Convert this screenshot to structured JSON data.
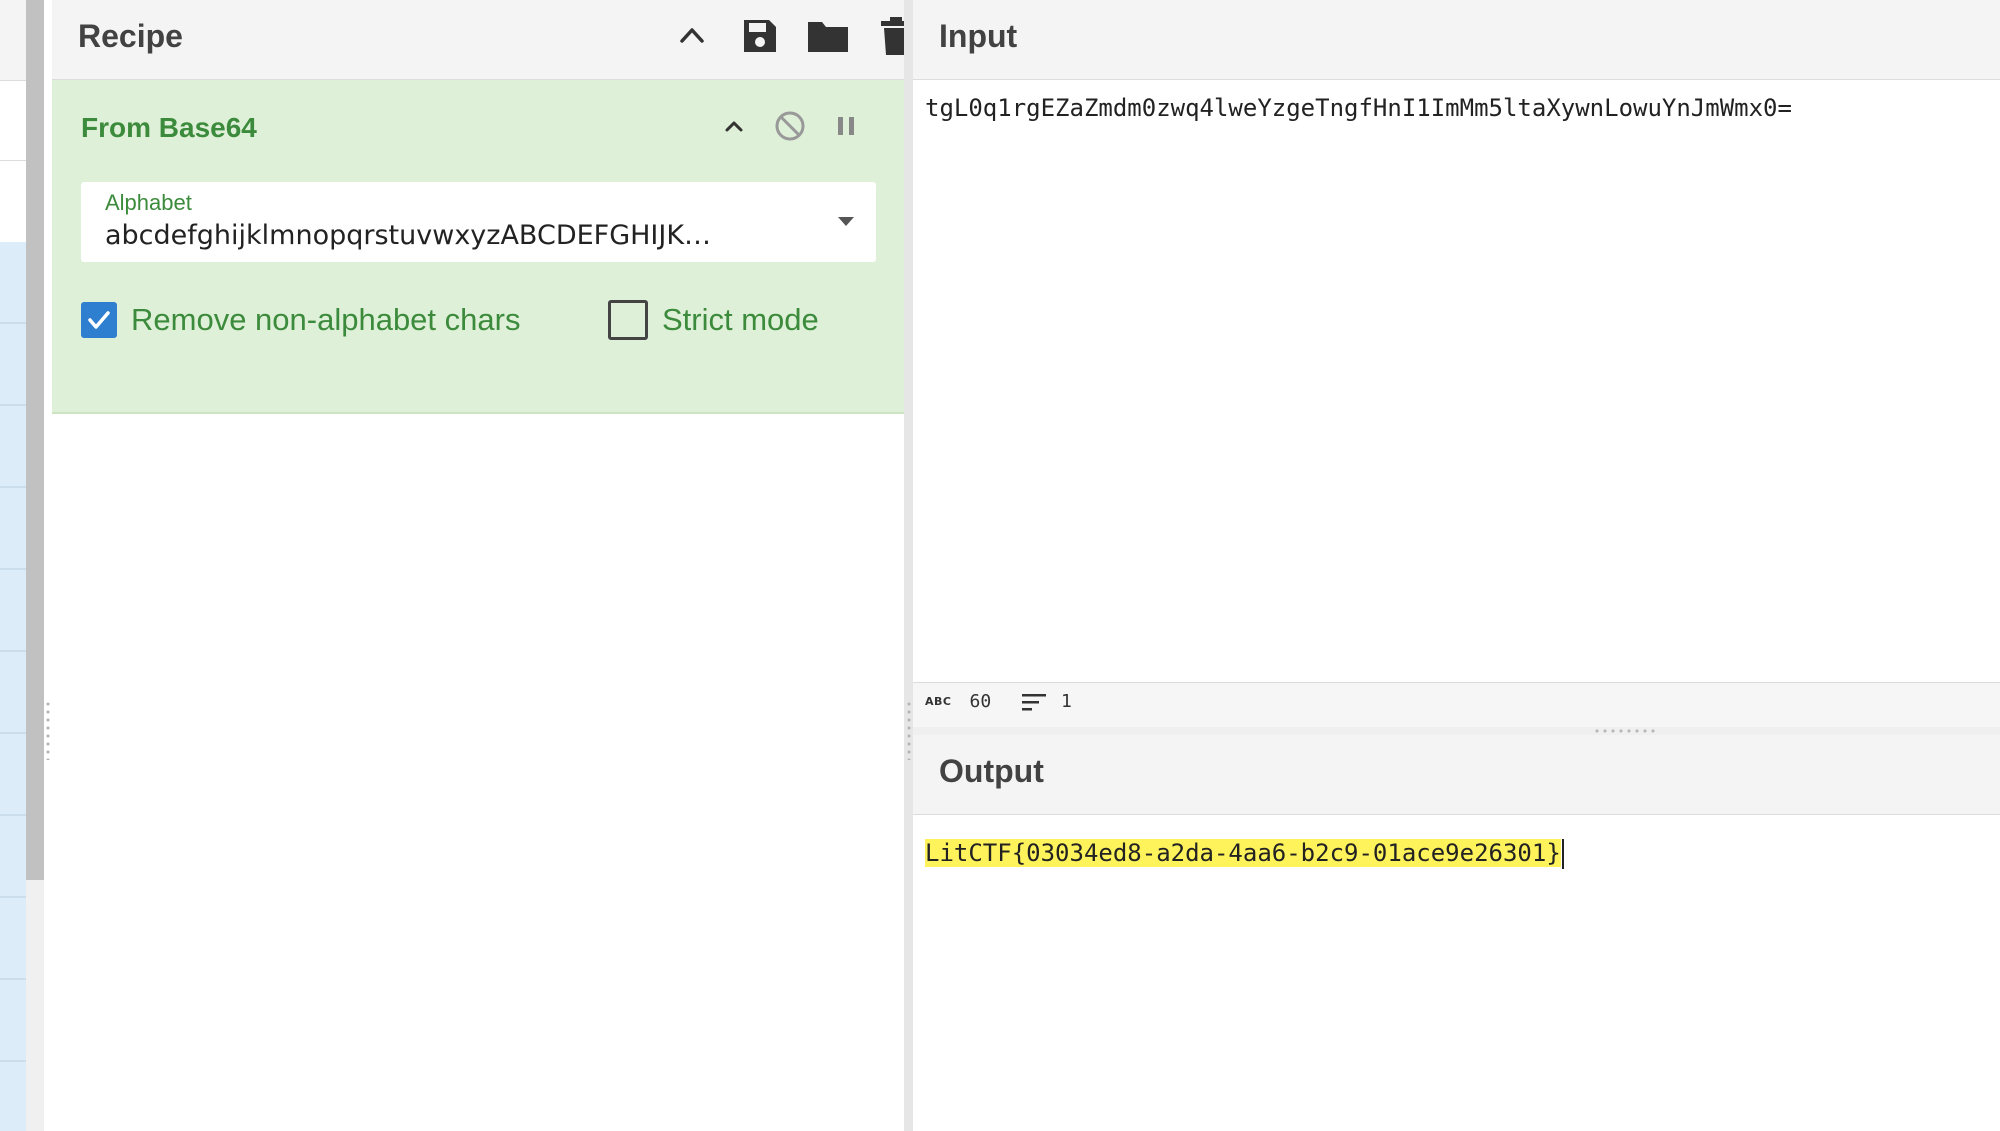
{
  "recipe": {
    "title": "Recipe",
    "operation": {
      "name": "From Base64",
      "alphabet_label": "Alphabet",
      "alphabet_value": "abcdefghijklmnopqrstuvwxyzABCDEFGHIJK…",
      "remove_nonalphabet_label": "Remove non-alphabet chars",
      "remove_nonalphabet_checked": true,
      "strict_mode_label": "Strict mode",
      "strict_mode_checked": false
    }
  },
  "input": {
    "title": "Input",
    "text": "tgL0q1rgEZaZmdm0zwq4lweYzgeTngfHnI1ImMm5ltaXywnLowuYnJmWmx0=",
    "status": {
      "length": "60",
      "lines": "1"
    }
  },
  "output": {
    "title": "Output",
    "text": "LitCTF{03034ed8-a2da-4aa6-b2c9-01ace9e26301}"
  },
  "colors": {
    "operation_bg": "#dff0d8",
    "operation_text": "#3c8b3c",
    "checkbox_on": "#2f7fd0",
    "output_highlight": "#fff35b"
  }
}
